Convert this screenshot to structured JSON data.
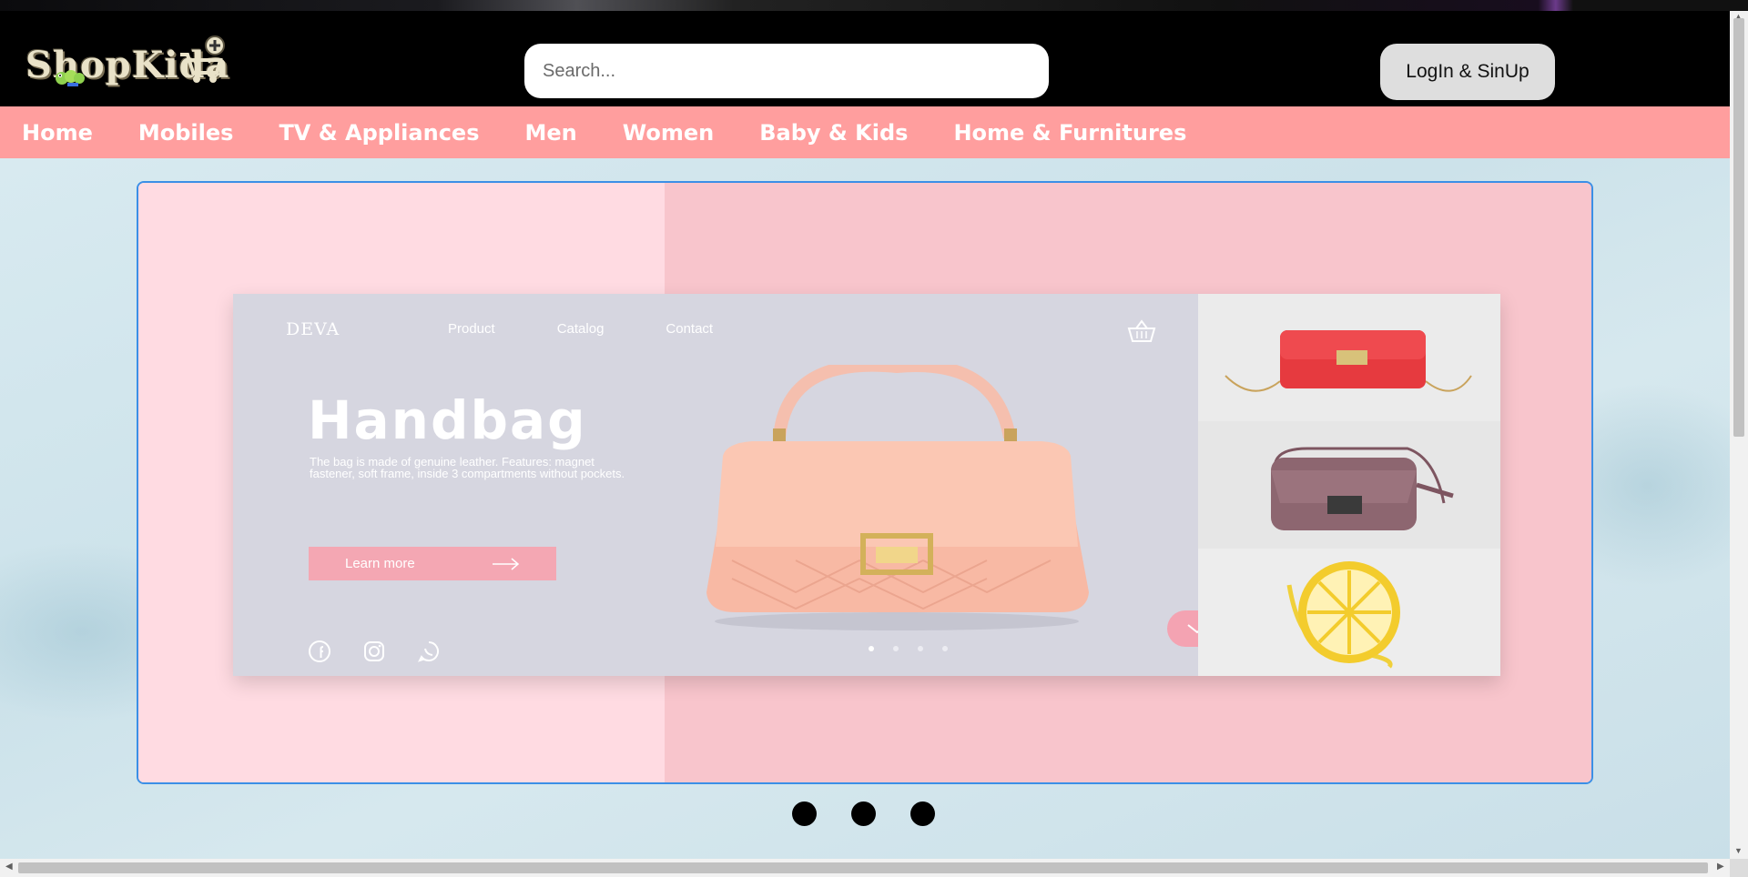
{
  "header": {
    "logo_text": "ShopKida",
    "search_placeholder": "Search...",
    "login_label": "LogIn & SinUp"
  },
  "nav": {
    "items": [
      {
        "label": "Home"
      },
      {
        "label": "Mobiles"
      },
      {
        "label": "TV & Appliances"
      },
      {
        "label": "Men"
      },
      {
        "label": "Women"
      },
      {
        "label": "Baby & Kids"
      },
      {
        "label": "Home & Furnitures"
      }
    ]
  },
  "slide": {
    "brand": "DEVA",
    "nav": [
      "Product",
      "Catalog",
      "Contact"
    ],
    "title": "Handbag",
    "description": "The bag is made of genuine leather. Features: magnet fastener, soft frame, inside 3 compartments without pockets.",
    "button_label": "Learn more",
    "dots_count": 4,
    "active_dot": 0
  },
  "carousel": {
    "indicator_count": 3
  },
  "colors": {
    "header_bg": "#000000",
    "nav_bg": "#ff9e9e",
    "carousel_border": "#3b8fe6",
    "slide_left": "#ffdbe2",
    "slide_right": "#f8c5cc",
    "accent_pink": "#f4a7b3"
  }
}
